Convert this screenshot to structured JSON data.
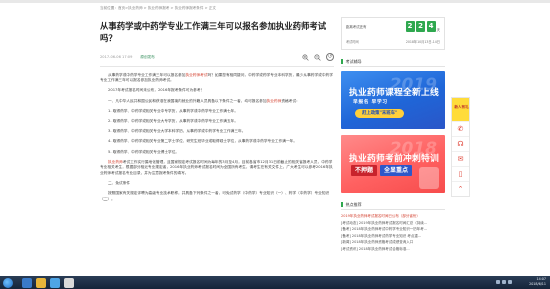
{
  "breadcrumb": "当前位置：首页>执业药师 > 执业药师报考 > 执业药师报考条件 > 正文",
  "article": {
    "title": "从事药学或中药学专业工作满三年可以报名参加执业药师考试吗？",
    "date": "2017-06-06 17:09",
    "source": "原创发布",
    "paragraphs": [
      {
        "pre": "从事药学或中药学专业工作满三年可以报名参加",
        "link": "执业药师考试",
        "post": "吗？如果您有相同疑问，中药学或药学专业本科学历，最少从事药学或中药学专业工作满三年可以报名参加执业药师考试。"
      },
      {
        "pre": "2017年考试报名时间未公布，2016年报考条件可为参考！",
        "link": "",
        "post": ""
      },
      {
        "pre": "一、凡中华人民共和国公民和获准在我国境内就业的外籍人员具备以下条件之一者，均可报名参加",
        "link": "执业药师",
        "post": "资格考试："
      },
      {
        "pre": "1. 取得药学、中药学或相关专业中专学历，从事药学或中药学专业工作满七年。",
        "link": "",
        "post": ""
      },
      {
        "pre": "2. 取得药学、中药学或相关专业大专学历，从事药学或中药学专业工作满五年。",
        "link": "",
        "post": ""
      },
      {
        "pre": "3. 取得药学、中药学或相关专业大学本科学历，从事药学或中药学专业工作满三年。",
        "link": "",
        "post": ""
      },
      {
        "pre": "4. 取得药学、中药学或相关专业第二学士学位、研究生班毕业或取得硕士学位，从事药学或中药学专业工作满一年。",
        "link": "",
        "post": ""
      },
      {
        "pre": "5. 取得药学、中药学或相关专业博士学位。",
        "link": "",
        "post": ""
      },
      {
        "pre": "",
        "link": "执业药师",
        "post": "考试工作实行属地化管理，且国家规定考试报名时间为每年的3月至4月，目前各省市12月31日前截止的相关省报考人员，中药学专业相关考生，根据部分相近专业规定者，2016年执业药师考试报名时间为全国所有考生，请考生在有关文件上，广大考生可以参考2016年执业药师考试报名专业目录，并为注意报考条件的填写。"
      },
      {
        "pre": "二、免试条件",
        "link": "",
        "post": ""
      },
      {
        "pre": "按照国家有关规定评聘为高级专业技术职称，并具备下列条件之一者，可免试药学（中药学）专业知识（一）、药学（中药学）专业知识（二）。",
        "link": "",
        "post": ""
      }
    ]
  },
  "countdown": {
    "label": "距离考试还有",
    "digits": [
      "2",
      "2",
      "4"
    ],
    "unit": "天",
    "row2_label": "考试时间",
    "row2_value": "2018年10月13日-14日"
  },
  "sidebar": {
    "section1": "考试辅导",
    "banner1": {
      "year": "2019",
      "main": "执业药师课程全新上线",
      "sub": "早报名 早学习",
      "btn": "赶上政策\"末班车\""
    },
    "banner2": {
      "year": "2018",
      "main": "执业药师考前冲刺特训",
      "pill_left": "不押题",
      "pill_right": "全显重点"
    },
    "section2": "热点推荐",
    "hot_items": [
      "2019年执业药师考试报名时间已公布（部分省份）",
      "[考试动态] 2019年执业药师考试报名时间汇总（持续...",
      "[备考] 2018年执业药师考试中药学专业知识一历年考...",
      "[备考] 2018年执业药师考试药学专业知识 考点重...",
      "[新闻] 2018年执业药师资格考试成绩查询入口",
      "[考试资讯] 2018年执业药师考试合格标准..."
    ]
  },
  "float_bar": {
    "top_label": "新人有礼",
    "icons": [
      "phone-icon",
      "headset-icon",
      "chat-icon",
      "mobile-icon",
      "top-icon"
    ]
  },
  "taskbar": {
    "time": "14:07",
    "date": "2018/6/11"
  },
  "colors": {
    "accent_green": "#2fa84f",
    "link_red": "#d23c2a",
    "banner_blue": "#1f66d8",
    "banner_red": "#ff6161"
  }
}
